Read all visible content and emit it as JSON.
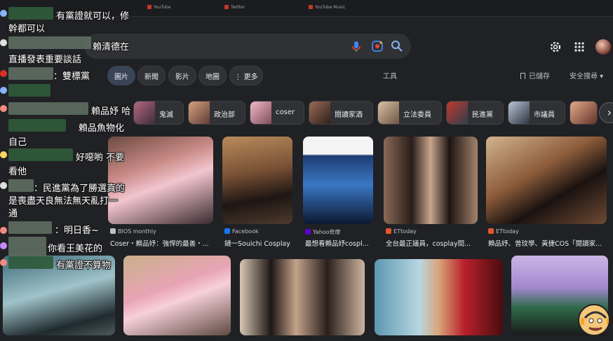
{
  "bookmarks": [
    "YouTube",
    "Twitter",
    "YouTube Music"
  ],
  "search": {
    "query": "賴清德在",
    "mic_icon": "mic-icon",
    "lens_icon": "google-lens-icon",
    "search_icon": "search-icon"
  },
  "header": {
    "settings_icon": "gear-icon",
    "apps_icon": "apps-grid-icon"
  },
  "tabs": [
    {
      "label": "圖片",
      "active": true
    },
    {
      "label": "新聞",
      "active": false
    },
    {
      "label": "影片",
      "active": false
    },
    {
      "label": "地圖",
      "active": false
    },
    {
      "label": "⋮ 更多",
      "active": false
    }
  ],
  "tools_label": "工具",
  "saved_label": "已儲存",
  "safesearch_label": "安全搜尋 ▾",
  "chips": [
    "鬼滅",
    "政治部",
    "coser",
    "閱讀家酒",
    "立法委員",
    "民進黨",
    "市議員"
  ],
  "results_row1": [
    {
      "source": "BIOS monthly",
      "title": "Coser・賴品妤：強悍的最善・..."
    },
    {
      "source": "Facebook",
      "title": "鏈一Souichi Cosplay"
    },
    {
      "source": "Yahoo奇摩",
      "title": "最想看賴品妤cospl..."
    },
    {
      "source": "ETtoday",
      "title": "全台最正議員，cosplay間..."
    },
    {
      "source": "ETtoday",
      "title": "賴品妤、曾玟學、黃捷COS「閱讀家..."
    }
  ],
  "chat": [
    "有黨證就可以，修",
    "幹都可以",
    "賴清德在",
    "直播發表重要談話",
    "：雙標黨",
    "賴品妤 哈",
    "賴品魚物化",
    "自己",
    "好噁喲 不要",
    "看他",
    "：民進黨為了勝選真的",
    "是喪盡天良無法無天亂打一",
    "通",
    "：明日香~",
    "你看王美花的",
    "有黨證不算物"
  ],
  "colors": {
    "background": "#202124",
    "surface": "#303134",
    "active_tab": "#394457",
    "accent_blue": "#8ab4f8"
  }
}
